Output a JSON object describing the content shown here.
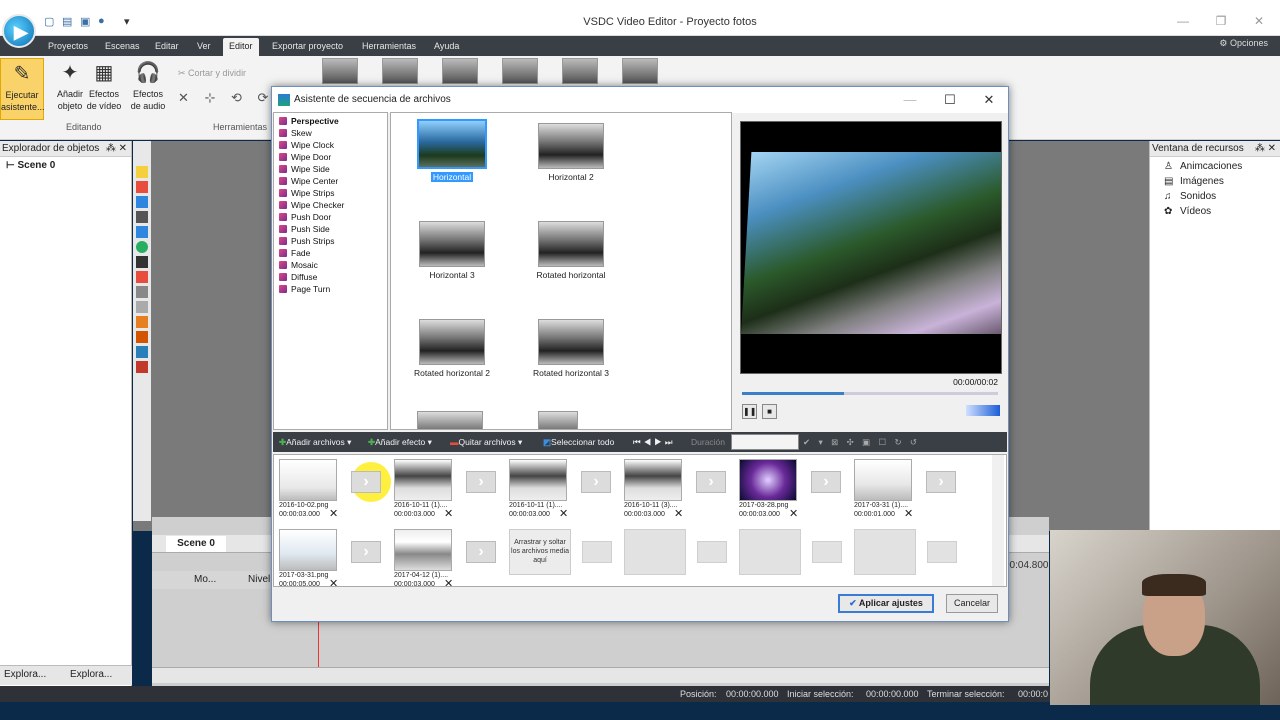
{
  "app": {
    "title": "VSDC Video Editor - Proyecto fotos",
    "menu_tabs": [
      "Proyectos",
      "Escenas",
      "Editar",
      "Ver",
      "Editor",
      "Exportar proyecto",
      "Herramientas",
      "Ayuda"
    ],
    "active_tab": "Editor",
    "opciones": "Opciones"
  },
  "ribbon": {
    "ejecutar_line1": "Ejecutar",
    "ejecutar_line2": "asistente...",
    "anadir_line1": "Añadir",
    "anadir_line2": "objeto",
    "efectos_video_line1": "Efectos",
    "efectos_video_line2": "de vídeo",
    "efectos_audio_line1": "Efectos",
    "efectos_audio_line2": "de audio",
    "cortar": "Cortar y dividir",
    "group_editando": "Editando",
    "group_herramientas": "Herramientas"
  },
  "left_panel": {
    "title": "Explorador de objetos",
    "scene": "Scene 0",
    "tab1": "Explora...",
    "tab2": "Explora..."
  },
  "right_panel": {
    "title": "Ventana de recursos",
    "items": [
      "Animcaciones",
      "Imágenes",
      "Sonidos",
      "Vídeos"
    ]
  },
  "timeline": {
    "scene_tab": "Scene 0",
    "col_mo": "Mo...",
    "col_nivel": "Nivel",
    "time": "00:04.800"
  },
  "status": {
    "posicion_label": "Posición:",
    "posicion_value": "00:00:00.000",
    "inicio_label": "Iniciar selección:",
    "inicio_value": "00:00:00.000",
    "fin_label": "Terminar selección:",
    "fin_value": "00:00:0"
  },
  "dialog": {
    "title": "Asistente de secuencia de archivos",
    "transitions": [
      "Perspective",
      "Skew",
      "Wipe Clock",
      "Wipe Door",
      "Wipe Side",
      "Wipe Center",
      "Wipe Strips",
      "Wipe Checker",
      "Push Door",
      "Push Side",
      "Push Strips",
      "Fade",
      "Mosaic",
      "Diffuse",
      "Page Turn"
    ],
    "selected_transition": "Perspective",
    "gallery": [
      "Horizontal",
      "Horizontal 2",
      "Horizontal 3",
      "Rotated horizontal",
      "Rotated horizontal 2",
      "Rotated horizontal 3"
    ],
    "selected_gallery": "Horizontal",
    "preview_time": "00:00/00:02",
    "preview_progress": 0.4,
    "toolbar": {
      "add_files": "Añadir archivos",
      "add_effect": "Añadir efecto",
      "remove_files": "Quitar archivos",
      "select_all": "Seleccionar todo",
      "duration": "Duración"
    },
    "sequence": [
      {
        "name": "2016-10-02.png",
        "time": "00:00:03.000"
      },
      {
        "name": "2016-10-11 (1)....",
        "time": "00:00:03.000"
      },
      {
        "name": "2016-10-11 (1)....",
        "time": "00:00:03.000"
      },
      {
        "name": "2016-10-11 (3)....",
        "time": "00:00:03.000"
      },
      {
        "name": "2017-03-28.png",
        "time": "00:00:03.000"
      },
      {
        "name": "2017-03-31 (1)....",
        "time": "00:00:01.000"
      },
      {
        "name": "2017-03-31.png",
        "time": "00:00:05.000"
      },
      {
        "name": "2017-04-12 (1)....",
        "time": "00:00:03.000"
      }
    ],
    "drop_hint": "Arrastrar y soltar los archivos media aquí",
    "apply": "Aplicar ajustes",
    "cancel": "Cancelar"
  }
}
